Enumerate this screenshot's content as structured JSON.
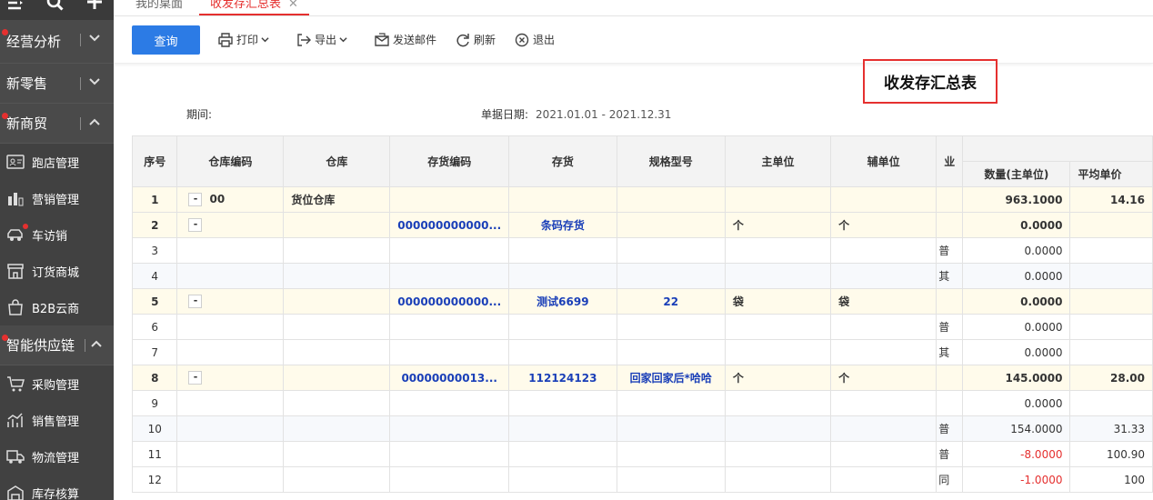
{
  "sidebar": {
    "groups": {
      "g1": {
        "label": "经营分析"
      },
      "g2": {
        "label": "新零售"
      },
      "g3": {
        "label": "新商贸"
      },
      "g4": {
        "label": "智能供应链"
      }
    },
    "items": {
      "i1": "跑店管理",
      "i2": "营销管理",
      "i3": "车访销",
      "i4": "订货商城",
      "i5": "B2B云商",
      "i6": "采购管理",
      "i7": "销售管理",
      "i8": "物流管理",
      "i9": "库存核算"
    }
  },
  "tabs": {
    "t1": "我的桌面",
    "t2": "收发存汇总表"
  },
  "toolbar": {
    "query": "查询",
    "print": "打印",
    "export": "导出",
    "email": "发送邮件",
    "refresh": "刷新",
    "exit": "退出"
  },
  "report": {
    "title": "收发存汇总表",
    "period_label": "期间:",
    "date_label": "单据日期:",
    "date_value": "2021.01.01 - 2021.12.31"
  },
  "table": {
    "headers": {
      "seq": "序号",
      "wh_code": "仓库编码",
      "wh": "仓库",
      "inv_code": "存货编码",
      "inv": "存货",
      "spec": "规格型号",
      "main_unit": "主单位",
      "aux_unit": "辅单位",
      "biz": "业",
      "qty": "数量(主单位)",
      "avg_price": "平均单价"
    },
    "rows": [
      {
        "seq": "1",
        "exp": "-",
        "wh_code": "00",
        "wh": "货位仓库",
        "inv_code": "",
        "inv": "",
        "spec": "",
        "mu": "",
        "au": "",
        "biz": "",
        "qty": "963.1000",
        "price": "14.16"
      },
      {
        "seq": "2",
        "exp": "-",
        "wh_code": "",
        "wh": "",
        "inv_code": "000000000000...",
        "inv": "条码存货",
        "spec": "",
        "mu": "个",
        "au": "个",
        "biz": "",
        "qty": "0.0000",
        "price": ""
      },
      {
        "seq": "3",
        "exp": "",
        "wh_code": "",
        "wh": "",
        "inv_code": "",
        "inv": "",
        "spec": "",
        "mu": "",
        "au": "",
        "biz": "普",
        "qty": "0.0000",
        "price": ""
      },
      {
        "seq": "4",
        "exp": "",
        "wh_code": "",
        "wh": "",
        "inv_code": "",
        "inv": "",
        "spec": "",
        "mu": "",
        "au": "",
        "biz": "其",
        "qty": "0.0000",
        "price": ""
      },
      {
        "seq": "5",
        "exp": "-",
        "wh_code": "",
        "wh": "",
        "inv_code": "000000000000...",
        "inv": "测试6699",
        "spec": "22",
        "mu": "袋",
        "au": "袋",
        "biz": "",
        "qty": "0.0000",
        "price": ""
      },
      {
        "seq": "6",
        "exp": "",
        "wh_code": "",
        "wh": "",
        "inv_code": "",
        "inv": "",
        "spec": "",
        "mu": "",
        "au": "",
        "biz": "普",
        "qty": "0.0000",
        "price": ""
      },
      {
        "seq": "7",
        "exp": "",
        "wh_code": "",
        "wh": "",
        "inv_code": "",
        "inv": "",
        "spec": "",
        "mu": "",
        "au": "",
        "biz": "其",
        "qty": "0.0000",
        "price": ""
      },
      {
        "seq": "8",
        "exp": "-",
        "wh_code": "",
        "wh": "",
        "inv_code": "00000000013...",
        "inv": "112124123",
        "spec": "回家回家后*哈哈",
        "mu": "个",
        "au": "个",
        "biz": "",
        "qty": "145.0000",
        "price": "28.00"
      },
      {
        "seq": "9",
        "exp": "",
        "wh_code": "",
        "wh": "",
        "inv_code": "",
        "inv": "",
        "spec": "",
        "mu": "",
        "au": "",
        "biz": "",
        "qty": "0.0000",
        "price": ""
      },
      {
        "seq": "10",
        "exp": "",
        "wh_code": "",
        "wh": "",
        "inv_code": "",
        "inv": "",
        "spec": "",
        "mu": "",
        "au": "",
        "biz": "普",
        "qty": "154.0000",
        "price": "31.33"
      },
      {
        "seq": "11",
        "exp": "",
        "wh_code": "",
        "wh": "",
        "inv_code": "",
        "inv": "",
        "spec": "",
        "mu": "",
        "au": "",
        "biz": "普",
        "qty": "-8.0000",
        "price": "100.90"
      },
      {
        "seq": "12",
        "exp": "",
        "wh_code": "",
        "wh": "",
        "inv_code": "",
        "inv": "",
        "spec": "",
        "mu": "",
        "au": "",
        "biz": "同",
        "qty": "-1.0000",
        "price": "100"
      }
    ]
  },
  "colors": {
    "accent": "#e5302f",
    "primary": "#2c7be5",
    "sidebar": "#414141",
    "link": "#1a3fb8"
  }
}
